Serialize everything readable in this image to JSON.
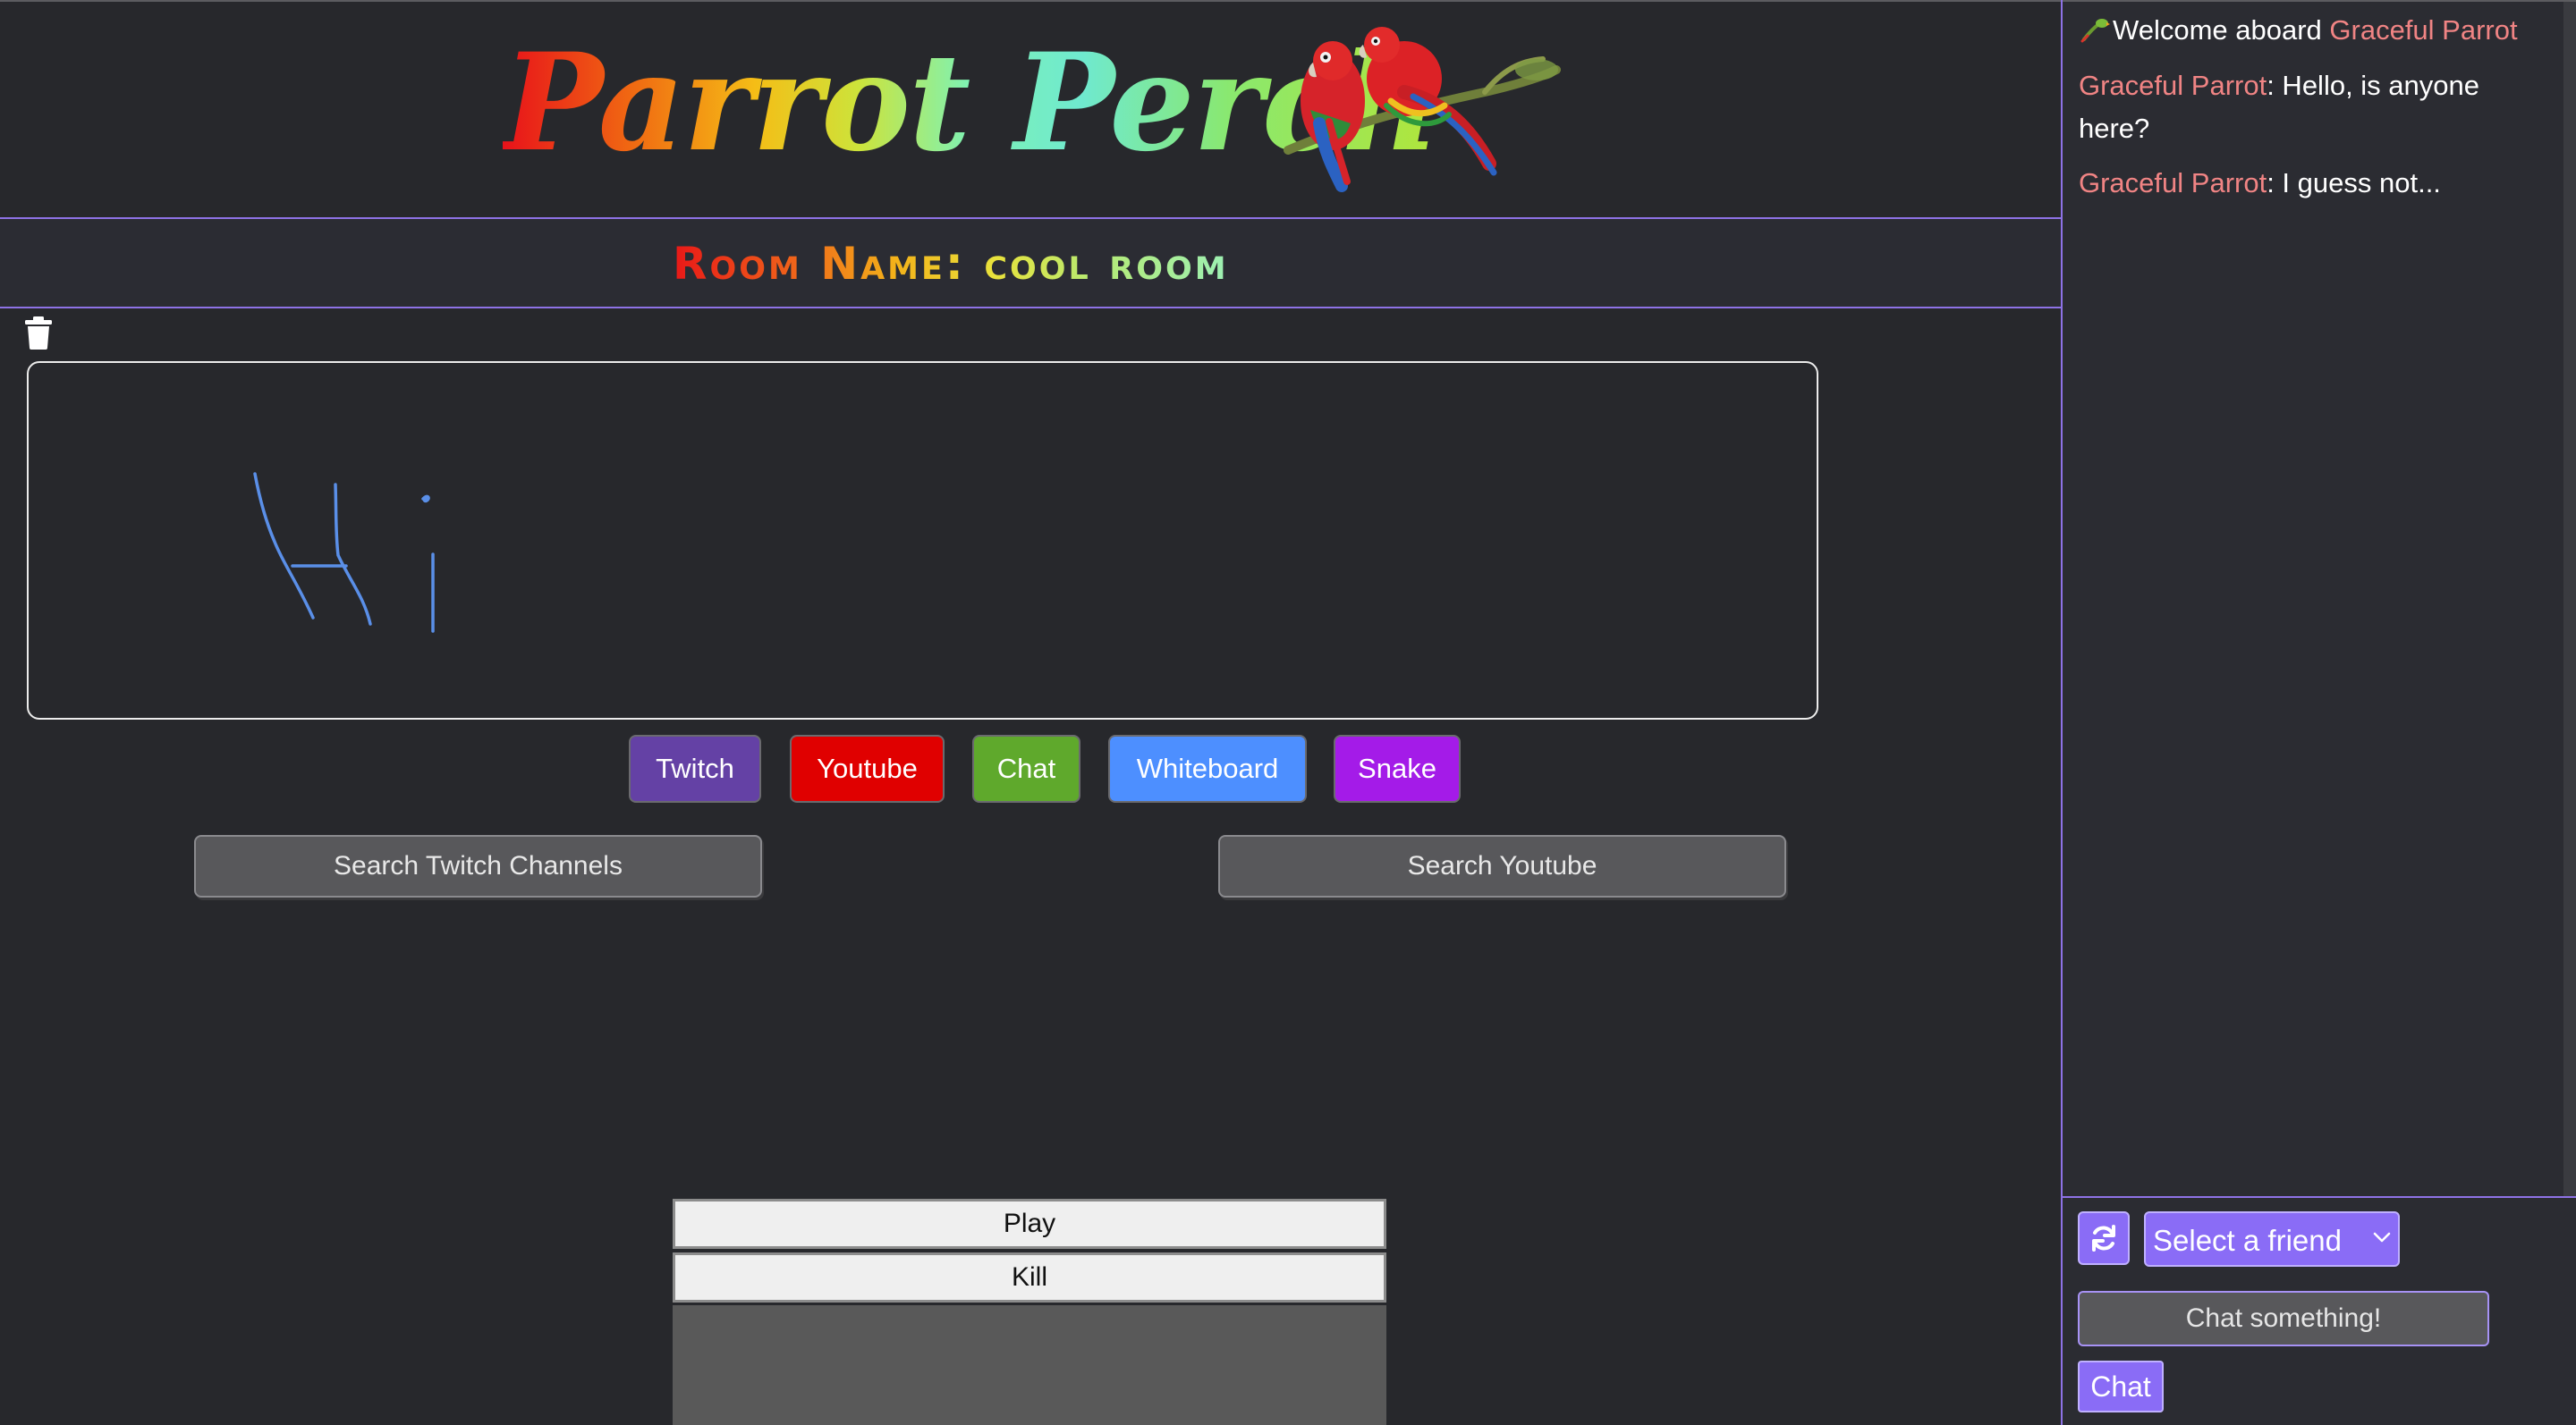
{
  "header": {
    "title": "Parrot Perch",
    "logo_icon": "parrots-on-branch-logo"
  },
  "room": {
    "label": "Room Name:",
    "name": "cool room"
  },
  "whiteboard": {
    "drawing_color": "#5a8fe8",
    "trash_icon": "trash-icon"
  },
  "tabs": [
    {
      "label": "Twitch",
      "color": "#6441a5"
    },
    {
      "label": "Youtube",
      "color": "#e00000"
    },
    {
      "label": "Chat",
      "color": "#5fa92c"
    },
    {
      "label": "Whiteboard",
      "color": "#4d8fff"
    },
    {
      "label": "Snake",
      "color": "#a41be8"
    }
  ],
  "search": {
    "twitch_label": "Search Twitch Channels",
    "youtube_label": "Search Youtube"
  },
  "snake": {
    "play_label": "Play",
    "kill_label": "Kill"
  },
  "chat": {
    "welcome_text": "Welcome aboard",
    "welcome_user": "Graceful Parrot",
    "messages": [
      {
        "user": "Graceful Parrot",
        "text": ": Hello, is anyone here?"
      },
      {
        "user": "Graceful Parrot",
        "text": ": I guess not..."
      }
    ],
    "username_color": "#f08484",
    "friend_select": "Select a friend",
    "input_placeholder": "Chat something!",
    "send_label": "Chat",
    "accent_color": "#8a6cf6"
  }
}
